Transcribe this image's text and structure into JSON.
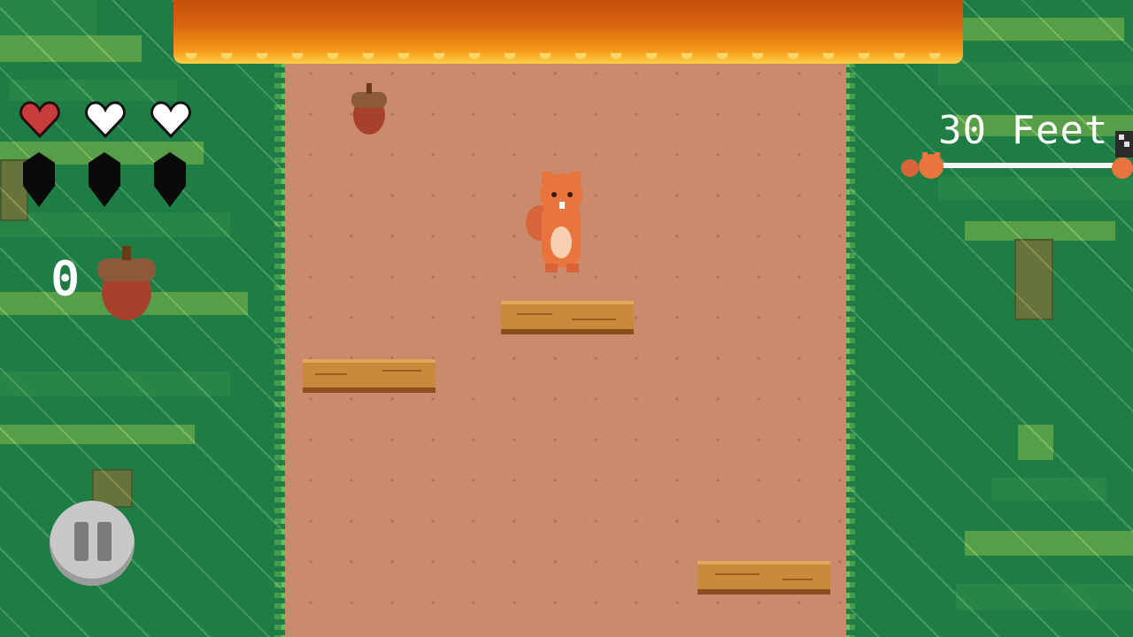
{
  "hud": {
    "hearts": [
      {
        "state": "full",
        "icon": "heart-icon"
      },
      {
        "state": "empty",
        "icon": "heart-icon"
      },
      {
        "state": "empty",
        "icon": "heart-icon"
      }
    ],
    "acorn_slots": [
      {
        "state": "empty",
        "icon": "acorn-silhouette-icon"
      },
      {
        "state": "empty",
        "icon": "acorn-silhouette-icon"
      },
      {
        "state": "empty",
        "icon": "acorn-silhouette-icon"
      }
    ],
    "acorn_count": "0",
    "distance_label": "30 Feet",
    "progress_fraction": 0.05
  },
  "colors": {
    "heart_full": "#c83c3c",
    "heart_empty": "#ffffff",
    "acorn": "#a8402e",
    "acorn_cap": "#8c5a3a",
    "lava": "#e26a10",
    "path": "#c98b6b",
    "grass": "#1e7d45"
  },
  "controls": {
    "pause_icon": "pause-icon"
  }
}
